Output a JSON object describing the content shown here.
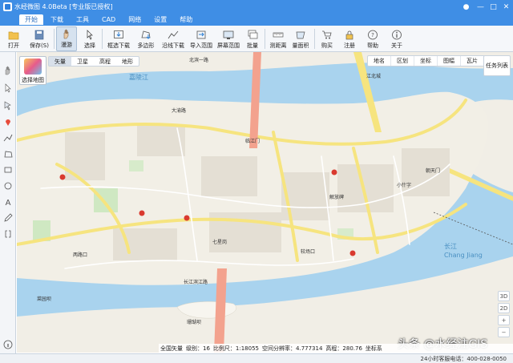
{
  "window": {
    "title": "水经微图 4.0Beta [专业版已授权]",
    "min_icon": "minimize-icon",
    "max_icon": "maximize-icon",
    "close_icon": "close-icon"
  },
  "menu": [
    "开始",
    "下载",
    "工具",
    "CAD",
    "网络",
    "设置",
    "帮助"
  ],
  "menu_active": "开始",
  "toolbar": {
    "open": "打开",
    "save": "保存(S)",
    "roam": "漫游",
    "select": "选择",
    "box_download": "框选下载",
    "polygon": "多边形",
    "line_download": "沿线下载",
    "import_range": "导入范围",
    "screen_range": "屏幕范围",
    "batch": "批量",
    "measure_distance": "测距离",
    "measure_area": "量面积",
    "buy": "购买",
    "register": "注册",
    "help": "帮助",
    "about": "关于"
  },
  "map_controls": {
    "layer_panel": "选择地图",
    "types": [
      "矢量",
      "卫星",
      "高程",
      "地形"
    ],
    "active_type": "矢量",
    "options": [
      "地名",
      "区划",
      "坐标",
      "图幅",
      "瓦片"
    ],
    "task_list": "任务列表",
    "zoom_3d": "3D",
    "zoom_2d": "2D"
  },
  "map_labels": {
    "river_north_road": "北滨一路",
    "jiangbei_road": "江北城",
    "dayangshi": "大渝路",
    "linjiangmen": "临江门",
    "jiefangbei": "解放碑",
    "chaotianmen": "朝天门",
    "xiaoshizi": "小什字",
    "jiaochangkou": "较场口",
    "qixinggang": "七星岗",
    "lianglukou": "两路口",
    "caiyuanba": "菜园坝",
    "zhushuidong": "珊瑚坝",
    "yangtze": "长江",
    "yangtze_pinyin": "Chang Jiang",
    "jialing": "嘉陵江",
    "nanjiang_road": "长江滨江路"
  },
  "status": {
    "map_type": "全国矢量",
    "level": "级别：16",
    "scale": "比例尺：1:18055",
    "resolution": "空间分辨率：4.777314",
    "elevation": "高程：280.76",
    "coord": "坐标系",
    "service": "24小时客服电话：400-028-0050"
  },
  "watermark": "头条 @水经注GIS"
}
